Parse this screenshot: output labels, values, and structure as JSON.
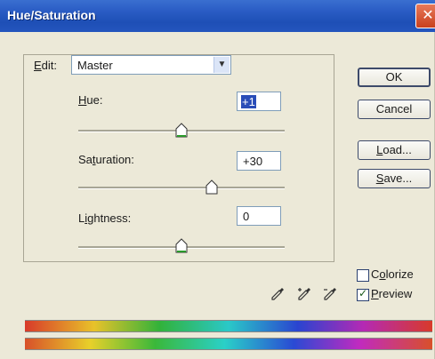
{
  "window": {
    "title": "Hue/Saturation",
    "close_glyph": "✕"
  },
  "edit": {
    "label_prefix": "",
    "label_key": "E",
    "label_rest": "dit:",
    "selected": "Master",
    "arrow": "▼"
  },
  "hue": {
    "label_key": "H",
    "label_rest": "ue:",
    "value": "+1",
    "level_percent": 50
  },
  "saturation": {
    "label_pre": "Sa",
    "label_key": "t",
    "label_rest": "uration:",
    "value": "+30",
    "level_percent": 65
  },
  "lightness": {
    "label_pre": "L",
    "label_key": "i",
    "label_rest": "ghtness:",
    "value": "0",
    "level_percent": 50
  },
  "buttons": {
    "ok": "OK",
    "cancel": "Cancel",
    "load_key": "L",
    "load_rest": "oad...",
    "save_key": "S",
    "save_rest": "ave..."
  },
  "options": {
    "colorize_pre": "C",
    "colorize_key": "o",
    "colorize_rest": "lorize",
    "colorize_checked": false,
    "preview_key": "P",
    "preview_rest": "review",
    "preview_checked": true
  },
  "icons": [
    "eyedropper-icon",
    "eyedropper-plus-icon",
    "eyedropper-minus-icon"
  ],
  "colors": {
    "titlebar": "#2a5cc4",
    "dialog_bg": "#ece9d8",
    "close_button": "#d8572f"
  }
}
